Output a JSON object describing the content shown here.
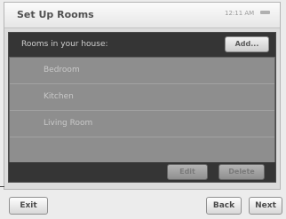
{
  "window": {
    "title": "Set Up Rooms",
    "time": "12:11 AM"
  },
  "panel": {
    "header_label": "Rooms in your house:",
    "add_label": "Add..."
  },
  "rooms": [
    {
      "label": "Bedroom"
    },
    {
      "label": "Kitchen"
    },
    {
      "label": "Living Room"
    }
  ],
  "actions": {
    "edit_label": "Edit",
    "delete_label": "Delete"
  },
  "nav": {
    "exit_label": "Exit",
    "back_label": "Back",
    "next_label": "Next"
  }
}
